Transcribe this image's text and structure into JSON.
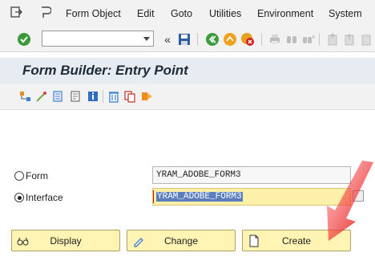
{
  "menubar": {
    "items": [
      "Form Object",
      "Edit",
      "Goto",
      "Utilities",
      "Environment",
      "System"
    ]
  },
  "toolbar": {
    "command_field": "",
    "icons": [
      "enter-icon",
      "back-icon",
      "save-icon",
      "back-green-icon",
      "exit-icon",
      "cancel-icon",
      "print-icon",
      "find-icon",
      "find-next-icon",
      "first-page-icon",
      "prev-page-icon"
    ]
  },
  "title": {
    "text": "Form Builder: Entry Point"
  },
  "form": {
    "form_label": "Form",
    "form_value": "YRAM_ADOBE_FORM3",
    "interface_label": "Interface",
    "interface_value": "YRAM_ADOBE_FORM3",
    "selected": "Interface"
  },
  "buttons": {
    "display": "Display",
    "change": "Change",
    "create": "Create"
  },
  "colors": {
    "title_bg": "#e6ecf2",
    "button_bg": "#fff4b3",
    "active_field": "#fdf0a8",
    "annotation": "#e02020"
  }
}
